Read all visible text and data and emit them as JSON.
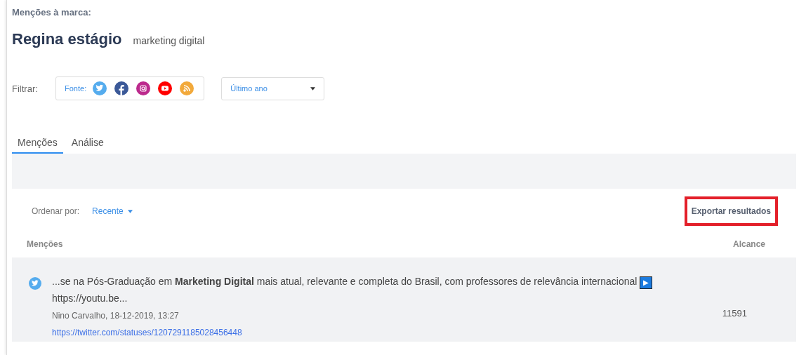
{
  "header": {
    "label": "Menções à marca:",
    "brand": "Regina estágio",
    "keyword": "marketing digital"
  },
  "filter": {
    "label": "Filtrar:",
    "source_label": "Fonte:",
    "sources": [
      {
        "kind": "twitter"
      },
      {
        "kind": "facebook"
      },
      {
        "kind": "instagram"
      },
      {
        "kind": "youtube"
      },
      {
        "kind": "rss"
      }
    ],
    "period": "Último ano"
  },
  "tabs": [
    {
      "label": "Menções",
      "selected": true
    },
    {
      "label": "Análise",
      "selected": false
    }
  ],
  "toolbar": {
    "sort_label": "Ordenar por:",
    "sort_value": "Recente",
    "export": {
      "label": "Exportar resultados",
      "highlighted": true
    }
  },
  "table": {
    "columns": [
      "Menções",
      "Alcance"
    ],
    "rows": [
      {
        "kind": "twitter",
        "text": "...se na Pós-Graduação em **Marketing Digital** mais atual, relevante e completa do Brasil, com professores de relevância internacional",
        "play_glyph": "▶",
        "text_end": "https://youtu.be...",
        "meta": "Nino Carvalho, 18-12-2019, 13:27",
        "link": "https://twitter.com/statuses/1207291185028456448",
        "reach": "11591"
      }
    ]
  }
}
